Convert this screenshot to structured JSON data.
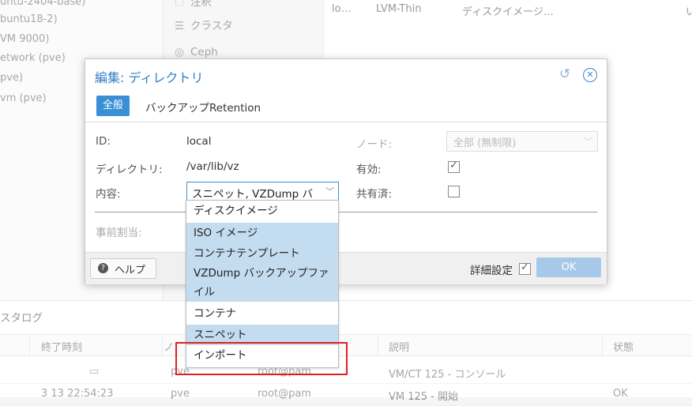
{
  "tree": [
    "untu-2404-base)",
    "buntu18-2)",
    "VM 9000)",
    "etwork (pve)",
    "pve)",
    "vm (pve)"
  ],
  "nav": [
    {
      "icon": "summary-icon",
      "glyph": "🗋",
      "label": "注釈"
    },
    {
      "icon": "cluster-icon",
      "glyph": "☰",
      "label": "クラスタ"
    },
    {
      "icon": "ceph-icon",
      "glyph": "◎",
      "label": "Ceph"
    }
  ],
  "storage_row": {
    "name": "lo…",
    "type": "LVM-Thin",
    "content": "ディスクイメージ…",
    "flag": "い"
  },
  "dialog": {
    "title": "編集: ディレクトリ",
    "tabs": {
      "active": "全般",
      "other": "バックアップRetention"
    },
    "labels": {
      "id": "ID:",
      "directory": "ディレクトリ:",
      "content": "内容:",
      "preallocation": "事前割当:",
      "node": "ノード:",
      "enabled": "有効:",
      "shared": "共有済:"
    },
    "values": {
      "id": "local",
      "directory": "/var/lib/vz",
      "content": "スニペット, VZDump バ",
      "node": "全部 (無制限)",
      "enabled": true,
      "shared": false
    },
    "footer": {
      "help": "ヘルプ",
      "advanced": "詳細設定",
      "advanced_checked": true,
      "ok": "OK"
    }
  },
  "dropdown": {
    "options": [
      {
        "label": "ディスクイメージ",
        "selected": false
      },
      {
        "label": "ISO イメージ",
        "selected": true
      },
      {
        "label": "コンテナテンプレート",
        "selected": true
      },
      {
        "label": "VZDump バックアップファイル",
        "selected": true
      },
      {
        "label": "コンテナ",
        "selected": false
      },
      {
        "label": "スニペット",
        "selected": true
      },
      {
        "label": "インポート",
        "selected": false
      }
    ]
  },
  "log": {
    "title": "スタログ",
    "columns": [
      "終了時刻",
      "ノ",
      "",
      "説明",
      "状態"
    ],
    "rows": [
      {
        "end": "",
        "node": "pve",
        "user": "root@pam",
        "desc": "VM/CT 125 - コンソール",
        "status": ""
      },
      {
        "end": "3 13 22:54:23",
        "node": "pve",
        "user": "root@pam",
        "desc": "VM 125 - 開始",
        "status": "OK"
      }
    ]
  },
  "colors": {
    "accent": "#3b8fd4",
    "highlight": "#c4dcf0",
    "annotation": "#e02020"
  }
}
